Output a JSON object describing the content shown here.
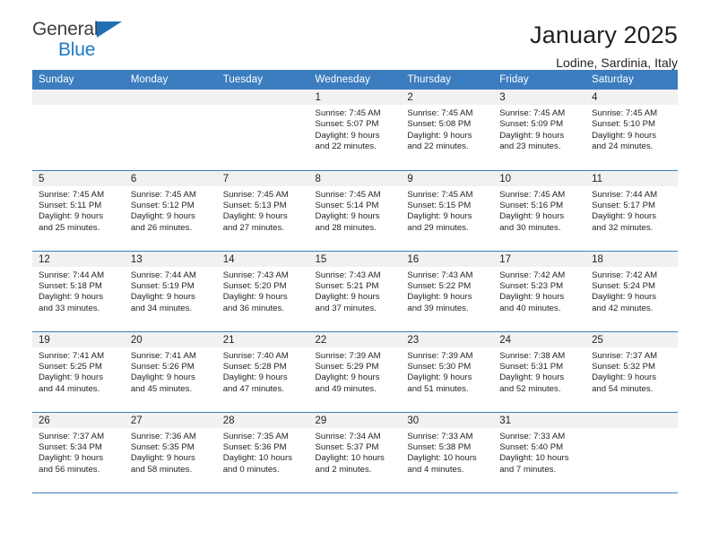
{
  "brand": {
    "name_top": "General",
    "name_bottom": "Blue",
    "accent_color": "#1f7ac4",
    "header_color": "#3c7dc0"
  },
  "header": {
    "title": "January 2025",
    "subtitle": "Lodine, Sardinia, Italy"
  },
  "calendar": {
    "weekday_headers": [
      "Sunday",
      "Monday",
      "Tuesday",
      "Wednesday",
      "Thursday",
      "Friday",
      "Saturday"
    ],
    "weeks": [
      [
        {
          "day": "",
          "lines": []
        },
        {
          "day": "",
          "lines": []
        },
        {
          "day": "",
          "lines": []
        },
        {
          "day": "1",
          "lines": [
            "Sunrise: 7:45 AM",
            "Sunset: 5:07 PM",
            "Daylight: 9 hours",
            "and 22 minutes."
          ]
        },
        {
          "day": "2",
          "lines": [
            "Sunrise: 7:45 AM",
            "Sunset: 5:08 PM",
            "Daylight: 9 hours",
            "and 22 minutes."
          ]
        },
        {
          "day": "3",
          "lines": [
            "Sunrise: 7:45 AM",
            "Sunset: 5:09 PM",
            "Daylight: 9 hours",
            "and 23 minutes."
          ]
        },
        {
          "day": "4",
          "lines": [
            "Sunrise: 7:45 AM",
            "Sunset: 5:10 PM",
            "Daylight: 9 hours",
            "and 24 minutes."
          ]
        }
      ],
      [
        {
          "day": "5",
          "lines": [
            "Sunrise: 7:45 AM",
            "Sunset: 5:11 PM",
            "Daylight: 9 hours",
            "and 25 minutes."
          ]
        },
        {
          "day": "6",
          "lines": [
            "Sunrise: 7:45 AM",
            "Sunset: 5:12 PM",
            "Daylight: 9 hours",
            "and 26 minutes."
          ]
        },
        {
          "day": "7",
          "lines": [
            "Sunrise: 7:45 AM",
            "Sunset: 5:13 PM",
            "Daylight: 9 hours",
            "and 27 minutes."
          ]
        },
        {
          "day": "8",
          "lines": [
            "Sunrise: 7:45 AM",
            "Sunset: 5:14 PM",
            "Daylight: 9 hours",
            "and 28 minutes."
          ]
        },
        {
          "day": "9",
          "lines": [
            "Sunrise: 7:45 AM",
            "Sunset: 5:15 PM",
            "Daylight: 9 hours",
            "and 29 minutes."
          ]
        },
        {
          "day": "10",
          "lines": [
            "Sunrise: 7:45 AM",
            "Sunset: 5:16 PM",
            "Daylight: 9 hours",
            "and 30 minutes."
          ]
        },
        {
          "day": "11",
          "lines": [
            "Sunrise: 7:44 AM",
            "Sunset: 5:17 PM",
            "Daylight: 9 hours",
            "and 32 minutes."
          ]
        }
      ],
      [
        {
          "day": "12",
          "lines": [
            "Sunrise: 7:44 AM",
            "Sunset: 5:18 PM",
            "Daylight: 9 hours",
            "and 33 minutes."
          ]
        },
        {
          "day": "13",
          "lines": [
            "Sunrise: 7:44 AM",
            "Sunset: 5:19 PM",
            "Daylight: 9 hours",
            "and 34 minutes."
          ]
        },
        {
          "day": "14",
          "lines": [
            "Sunrise: 7:43 AM",
            "Sunset: 5:20 PM",
            "Daylight: 9 hours",
            "and 36 minutes."
          ]
        },
        {
          "day": "15",
          "lines": [
            "Sunrise: 7:43 AM",
            "Sunset: 5:21 PM",
            "Daylight: 9 hours",
            "and 37 minutes."
          ]
        },
        {
          "day": "16",
          "lines": [
            "Sunrise: 7:43 AM",
            "Sunset: 5:22 PM",
            "Daylight: 9 hours",
            "and 39 minutes."
          ]
        },
        {
          "day": "17",
          "lines": [
            "Sunrise: 7:42 AM",
            "Sunset: 5:23 PM",
            "Daylight: 9 hours",
            "and 40 minutes."
          ]
        },
        {
          "day": "18",
          "lines": [
            "Sunrise: 7:42 AM",
            "Sunset: 5:24 PM",
            "Daylight: 9 hours",
            "and 42 minutes."
          ]
        }
      ],
      [
        {
          "day": "19",
          "lines": [
            "Sunrise: 7:41 AM",
            "Sunset: 5:25 PM",
            "Daylight: 9 hours",
            "and 44 minutes."
          ]
        },
        {
          "day": "20",
          "lines": [
            "Sunrise: 7:41 AM",
            "Sunset: 5:26 PM",
            "Daylight: 9 hours",
            "and 45 minutes."
          ]
        },
        {
          "day": "21",
          "lines": [
            "Sunrise: 7:40 AM",
            "Sunset: 5:28 PM",
            "Daylight: 9 hours",
            "and 47 minutes."
          ]
        },
        {
          "day": "22",
          "lines": [
            "Sunrise: 7:39 AM",
            "Sunset: 5:29 PM",
            "Daylight: 9 hours",
            "and 49 minutes."
          ]
        },
        {
          "day": "23",
          "lines": [
            "Sunrise: 7:39 AM",
            "Sunset: 5:30 PM",
            "Daylight: 9 hours",
            "and 51 minutes."
          ]
        },
        {
          "day": "24",
          "lines": [
            "Sunrise: 7:38 AM",
            "Sunset: 5:31 PM",
            "Daylight: 9 hours",
            "and 52 minutes."
          ]
        },
        {
          "day": "25",
          "lines": [
            "Sunrise: 7:37 AM",
            "Sunset: 5:32 PM",
            "Daylight: 9 hours",
            "and 54 minutes."
          ]
        }
      ],
      [
        {
          "day": "26",
          "lines": [
            "Sunrise: 7:37 AM",
            "Sunset: 5:34 PM",
            "Daylight: 9 hours",
            "and 56 minutes."
          ]
        },
        {
          "day": "27",
          "lines": [
            "Sunrise: 7:36 AM",
            "Sunset: 5:35 PM",
            "Daylight: 9 hours",
            "and 58 minutes."
          ]
        },
        {
          "day": "28",
          "lines": [
            "Sunrise: 7:35 AM",
            "Sunset: 5:36 PM",
            "Daylight: 10 hours",
            "and 0 minutes."
          ]
        },
        {
          "day": "29",
          "lines": [
            "Sunrise: 7:34 AM",
            "Sunset: 5:37 PM",
            "Daylight: 10 hours",
            "and 2 minutes."
          ]
        },
        {
          "day": "30",
          "lines": [
            "Sunrise: 7:33 AM",
            "Sunset: 5:38 PM",
            "Daylight: 10 hours",
            "and 4 minutes."
          ]
        },
        {
          "day": "31",
          "lines": [
            "Sunrise: 7:33 AM",
            "Sunset: 5:40 PM",
            "Daylight: 10 hours",
            "and 7 minutes."
          ]
        },
        {
          "day": "",
          "lines": []
        }
      ]
    ]
  }
}
